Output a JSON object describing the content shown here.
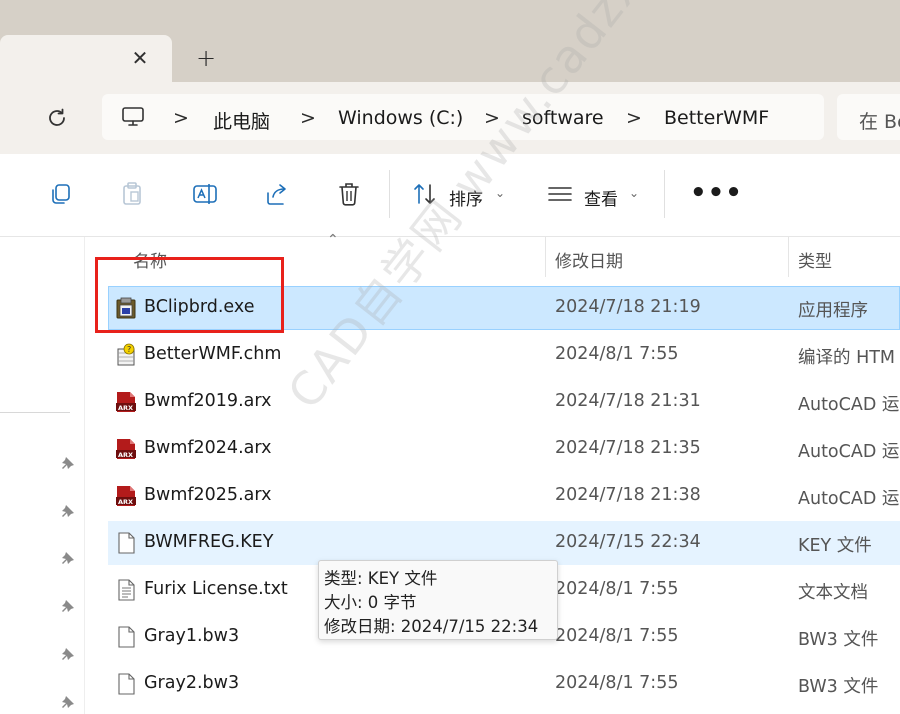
{
  "breadcrumb": [
    "此电脑",
    "Windows (C:)",
    "software",
    "BetterWMF"
  ],
  "search_placeholder": "在 Be",
  "toolbar": {
    "sort_label": "排序",
    "view_label": "查看",
    "more_label": "•••"
  },
  "tab": {
    "close": "✕",
    "new": "+"
  },
  "columns": {
    "name": "名称",
    "date": "修改日期",
    "type": "类型"
  },
  "files": [
    {
      "name": "BClipbrd.exe",
      "date": "2024/7/18 21:19",
      "type": "应用程序",
      "icon": "exe-icon"
    },
    {
      "name": "BetterWMF.chm",
      "date": "2024/8/1 7:55",
      "type": "编译的 HTM",
      "icon": "chm-icon"
    },
    {
      "name": "Bwmf2019.arx",
      "date": "2024/7/18 21:31",
      "type": "AutoCAD 运",
      "icon": "arx-icon"
    },
    {
      "name": "Bwmf2024.arx",
      "date": "2024/7/18 21:35",
      "type": "AutoCAD 运",
      "icon": "arx-icon"
    },
    {
      "name": "Bwmf2025.arx",
      "date": "2024/7/18 21:38",
      "type": "AutoCAD 运",
      "icon": "arx-icon"
    },
    {
      "name": "BWMFREG.KEY",
      "date": "2024/7/15 22:34",
      "type": "KEY 文件",
      "icon": "file-icon"
    },
    {
      "name": "Furix License.txt",
      "date": "2024/8/1 7:55",
      "type": "文本文档",
      "icon": "txt-icon"
    },
    {
      "name": "Gray1.bw3",
      "date": "2024/8/1 7:55",
      "type": "BW3 文件",
      "icon": "file-icon"
    },
    {
      "name": "Gray2.bw3",
      "date": "2024/8/1 7:55",
      "type": "BW3 文件",
      "icon": "file-icon"
    }
  ],
  "tooltip": {
    "type": "类型: KEY 文件",
    "size": "大小: 0 字节",
    "modified": "修改日期: 2024/7/15 22:34"
  },
  "watermark": "CAD自学网 www.cadzxw.com",
  "colors": {
    "selection": "#cce8ff",
    "hover": "#e5f3ff",
    "highlight_box": "#e8211b"
  }
}
